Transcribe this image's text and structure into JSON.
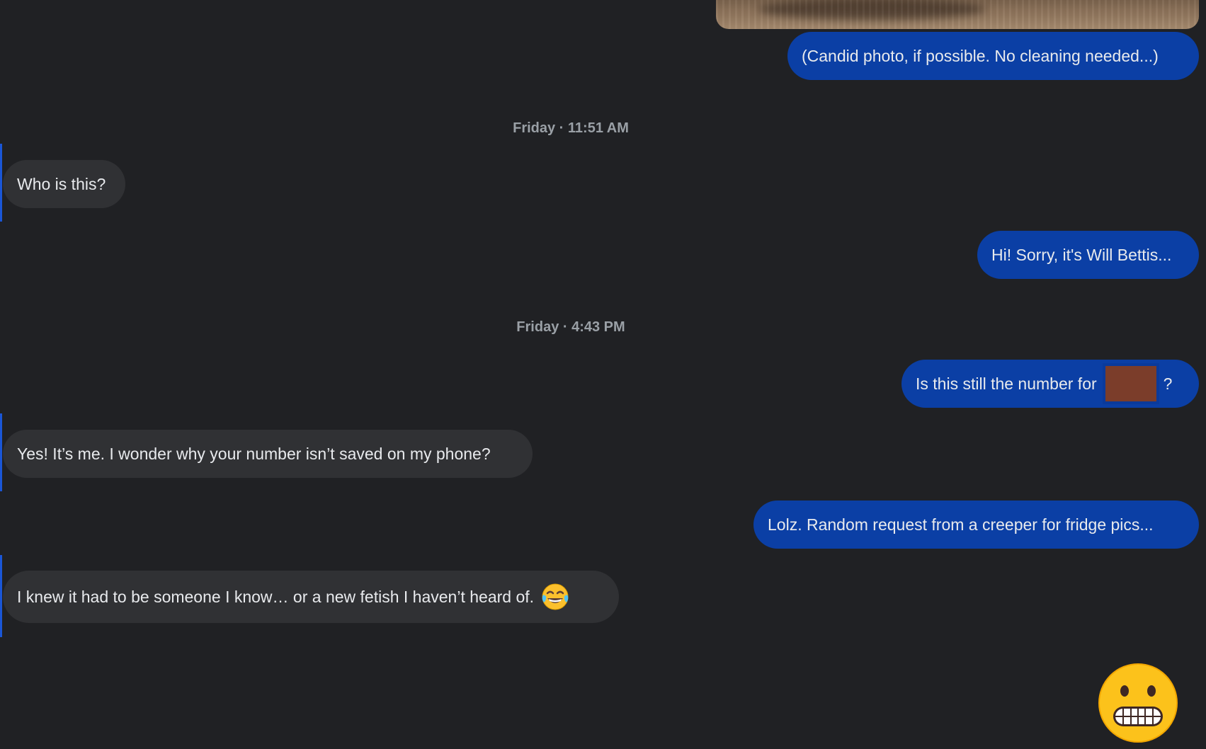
{
  "messages": {
    "m1_text": "(Candid photo, if possible. No cleaning needed...)",
    "ts1": "Friday · 11:51 AM",
    "m2_text": "Who is this?",
    "m3_text": "Hi! Sorry, it's Will Bettis...",
    "ts2": "Friday · 4:43 PM",
    "m4_text_before": "Is this still the number for",
    "m4_text_after": "?",
    "m5_text": "Yes! It’s me. I wonder why your number isn’t saved on my phone?",
    "m6_text": "Lolz. Random request from a creeper for fridge pics...",
    "m7_text": "I knew it had to be someone I know… or a new fetish I haven’t heard of."
  },
  "icons": {
    "laugh": "face-with-tears-of-joy-icon",
    "grimace": "grimacing-face-icon"
  },
  "colors": {
    "background": "#202124",
    "outgoing_bubble": "#0b3fa5",
    "incoming_bubble": "#303134",
    "timestamp_text": "#9aa0a6",
    "message_text": "#e8eaed",
    "redaction": "#7b3d2a"
  }
}
